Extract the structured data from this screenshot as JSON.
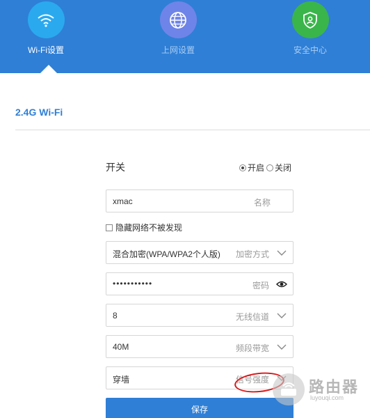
{
  "colors": {
    "header": "#2f7fd6",
    "wifi_circle": "#2aa9ef",
    "net_circle": "#6f84e8",
    "security_circle": "#3ab54a",
    "annotation": "#d7191c"
  },
  "nav": {
    "items": [
      {
        "label": "Wi-Fi设置",
        "icon": "wifi-icon",
        "active": true
      },
      {
        "label": "上网设置",
        "icon": "globe-icon",
        "active": false
      },
      {
        "label": "安全中心",
        "icon": "shield-icon",
        "active": false
      }
    ]
  },
  "section": {
    "title": "2.4G Wi-Fi"
  },
  "form": {
    "switch": {
      "label": "开关",
      "on": "开启",
      "off": "关闭",
      "selected": "on"
    },
    "name": {
      "value": "xmac",
      "hint": "名称"
    },
    "hidden": {
      "label": "隐藏网络不被发现",
      "checked": false
    },
    "encryption": {
      "value": "混合加密(WPA/WPA2个人版)",
      "hint": "加密方式",
      "icon": "chevron-down-icon"
    },
    "password": {
      "value": "•••••••••••",
      "hint": "密码",
      "icon": "eye-icon"
    },
    "channel": {
      "value": "8",
      "hint": "无线信道",
      "icon": "chevron-down-icon"
    },
    "bandwidth": {
      "value": "40M",
      "hint": "频段带宽",
      "icon": "chevron-down-icon"
    },
    "power": {
      "value": "穿墙",
      "hint": "信号强度",
      "icon": "chevron-down-icon"
    },
    "save_label": "保存"
  },
  "watermark": {
    "text": "路由器",
    "url": "luyouqi.com"
  }
}
